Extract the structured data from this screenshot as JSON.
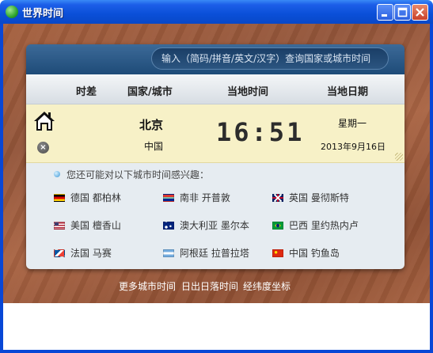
{
  "window": {
    "title": "世界时间"
  },
  "search": {
    "placeholder": "输入（简码/拼音/英文/汉字）查询国家或城市时间"
  },
  "columns": {
    "offset": "时差",
    "country_city": "国家/城市",
    "local_time": "当地时间",
    "local_date": "当地日期"
  },
  "home": {
    "city": "北京",
    "country": "中国",
    "time": "16:51",
    "weekday": "星期一",
    "date": "2013年9月16日"
  },
  "suggestions": {
    "hint": "您还可能对以下城市时间感兴趣：",
    "cities": [
      {
        "label": "德国 都柏林",
        "flag": "germany-flag-icon"
      },
      {
        "label": "南非 开普敦",
        "flag": "south-africa-flag-icon"
      },
      {
        "label": "英国 曼彻斯特",
        "flag": "uk-flag-icon"
      },
      {
        "label": "美国 檀香山",
        "flag": "usa-flag-icon"
      },
      {
        "label": "澳大利亚 墨尔本",
        "flag": "australia-flag-icon"
      },
      {
        "label": "巴西 里约热内卢",
        "flag": "brazil-flag-icon"
      },
      {
        "label": "法国 马赛",
        "flag": "france-flag-icon"
      },
      {
        "label": "阿根廷 拉普拉塔",
        "flag": "argentina-flag-icon"
      },
      {
        "label": "中国 钓鱼岛",
        "flag": "china-flag-icon"
      }
    ]
  },
  "footer": {
    "more_cities": "更多城市时间",
    "sunrise_sunset": "日出日落时间",
    "coordinates": "经纬度坐标"
  }
}
